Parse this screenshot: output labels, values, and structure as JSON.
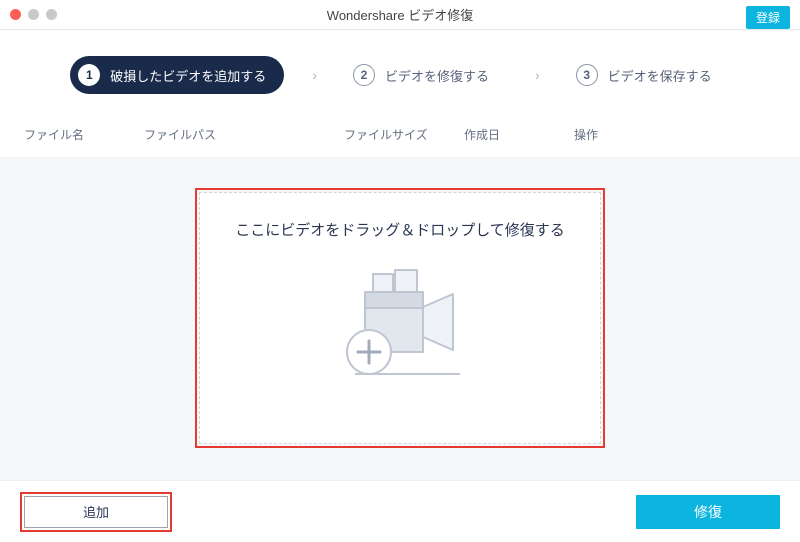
{
  "titlebar": {
    "title": "Wondershare ビデオ修復",
    "register": "登録"
  },
  "steps": {
    "items": [
      {
        "num": "1",
        "label": "破損したビデオを追加する"
      },
      {
        "num": "2",
        "label": "ビデオを修復する"
      },
      {
        "num": "3",
        "label": "ビデオを保存する"
      }
    ],
    "separator": "›"
  },
  "columns": {
    "name": "ファイル名",
    "path": "ファイルパス",
    "size": "ファイルサイズ",
    "date": "作成日",
    "action": "操作"
  },
  "dropzone": {
    "text": "ここにビデオをドラッグ＆ドロップして修復する"
  },
  "buttons": {
    "add": "追加",
    "repair": "修復"
  }
}
